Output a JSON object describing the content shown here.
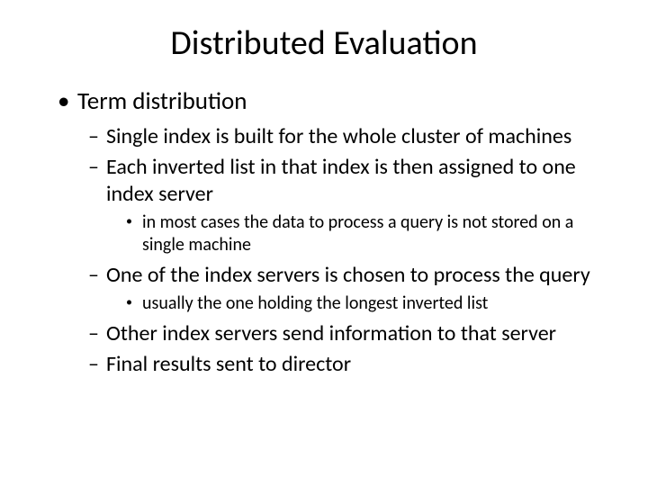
{
  "slide": {
    "title": "Distributed Evaluation",
    "l1_item": "Term distribution",
    "l2_items": {
      "i0": "Single index is built for the whole cluster of machines",
      "i1": "Each inverted list in that index is then assigned to one index server",
      "i2": "One of the index servers is chosen to process the query",
      "i3": "Other index servers send information to that server",
      "i4": "Final results sent to director"
    },
    "l3_items": {
      "i0": "in most cases the data to process a query is not stored on a single machine",
      "i1": "usually the one holding the longest inverted list"
    }
  }
}
